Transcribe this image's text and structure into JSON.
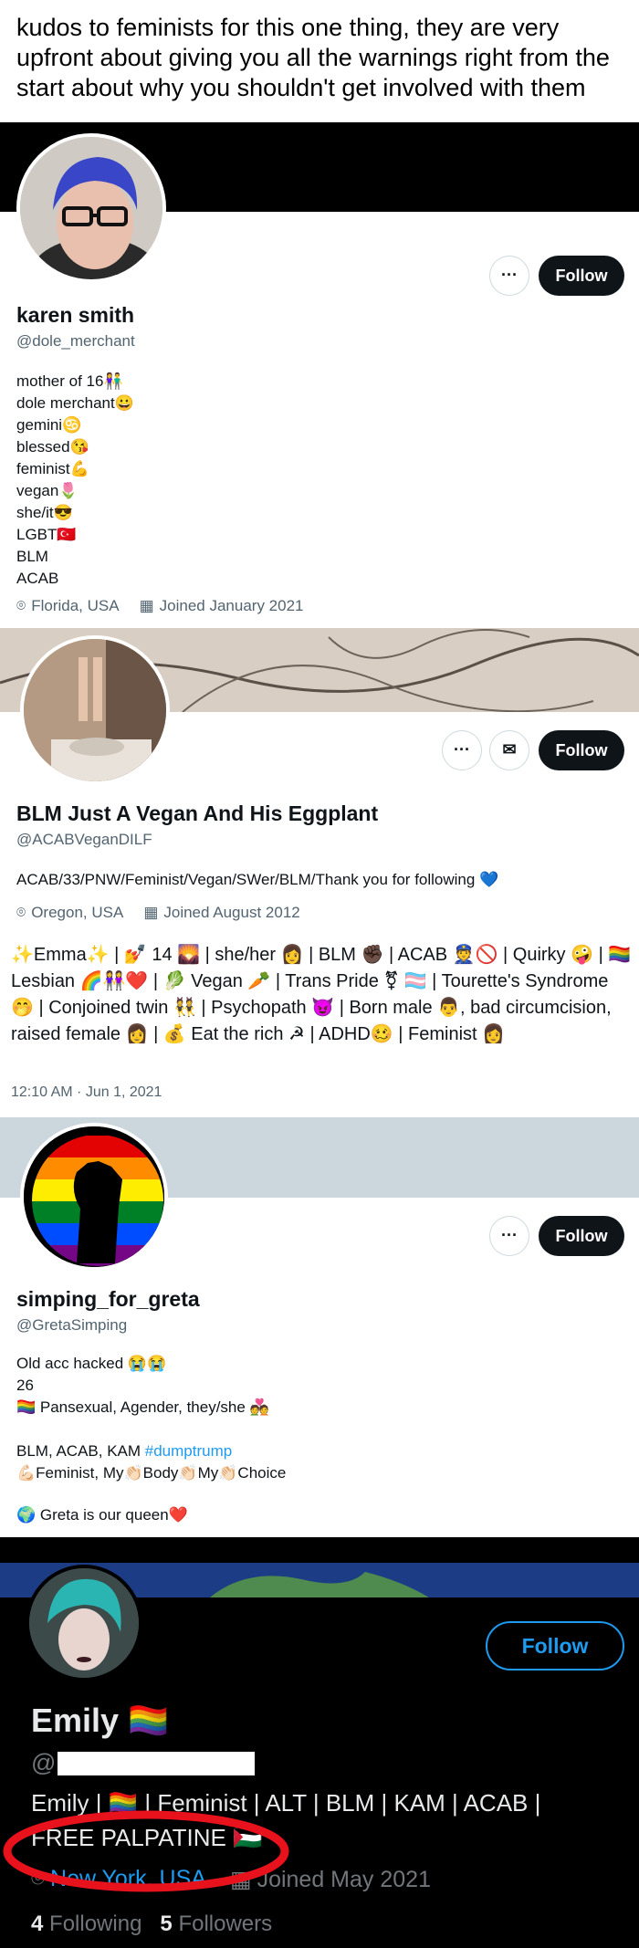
{
  "caption": "kudos to feminists for this one thing, they are very upfront about giving you all the warnings right from the start about why you shouldn't get involved with them",
  "profiles": [
    {
      "name": "karen smith",
      "handle": "@dole_merchant",
      "bio": "mother of 16👫\ndole merchant😀\ngemini♋\nblessed😘\nfeminist💪\nvegan🌷\nshe/it😎\nLGBT🇹🇷\nBLM\nACAB",
      "location": "Florida, USA",
      "joined": "Joined January 2021",
      "follow_label": "Follow",
      "more_label": "···"
    },
    {
      "name": "BLM Just A Vegan And His Eggplant",
      "handle": "@ACABVeganDILF",
      "bio": "ACAB/33/PNW/Feminist/Vegan/SWer/BLM/Thank you for following 💙",
      "location": "Oregon, USA",
      "joined": "Joined August 2012",
      "follow_label": "Follow",
      "more_label": "···",
      "mail_label": "✉",
      "tweet_text": "✨Emma✨ | 💅 14 🌄 | she/her 👩 | BLM ✊🏿 | ACAB 👮🚫 | Quirky 🤪 | 🏳️‍🌈 Lesbian 🌈👭❤️ | 🥬 Vegan 🥕 | Trans Pride ⚧ 🏳️‍⚧️ | Tourette's Syndrome 🤭 | Conjoined twin 👯 | Psychopath 😈 | Born male 👨, bad circumcision, raised female 👩 | 💰 Eat the rich ☭ | ADHD🥴 | Feminist 👩",
      "tweet_time": "12:10 AM · Jun 1, 2021"
    },
    {
      "name": "simping_for_greta",
      "handle": "@GretaSimping",
      "bio_line1": "Old acc hacked 😭😭",
      "bio_line2": "26",
      "bio_line3": "🏳️‍🌈 Pansexual, Agender, they/she 💑",
      "bio_line4_prefix": "BLM, ACAB, KAM ",
      "bio_line4_tag": "#dumptrump",
      "bio_line5": "💪🏻Feminist, My👏🏻Body👏🏻My👏🏻Choice",
      "bio_line6": "🌍 Greta is our queen❤️",
      "follow_label": "Follow",
      "more_label": "···"
    },
    {
      "name": "Emily 🏳️‍🌈",
      "handle_prefix": "@",
      "bio": "Emily | 🏳️‍🌈 | Feminist | ALT | BLM | KAM | ACAB | FREE PALPATINE 🇵🇸",
      "location": "New York, USA",
      "joined": "Joined May 2021",
      "following_count": "4",
      "following_label": "Following",
      "followers_count": "5",
      "followers_label": "Followers",
      "follow_label": "Follow"
    }
  ],
  "colors": {
    "annotation_red": "#e8121c",
    "link_blue": "#1d9bf0",
    "dark_bg": "#000000"
  }
}
